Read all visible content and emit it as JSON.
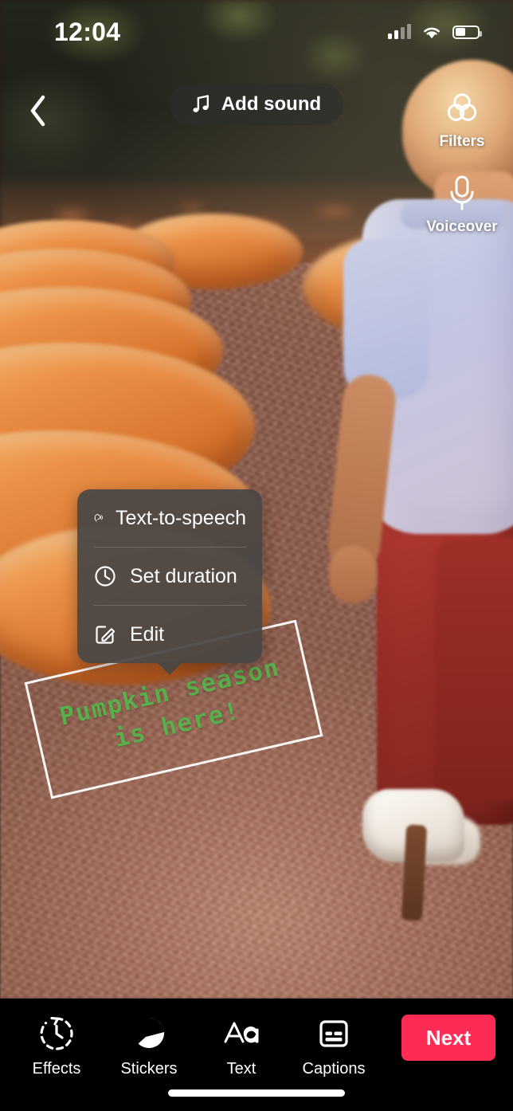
{
  "status_bar": {
    "time": "12:04",
    "signal_icon": "cellular-signal-icon",
    "wifi_icon": "wifi-icon",
    "battery_icon": "battery-icon"
  },
  "top_bar": {
    "back_icon": "back-chevron-icon",
    "add_sound_label": "Add sound",
    "add_sound_icon": "music-note-icon"
  },
  "right_rail": {
    "items": [
      {
        "label": "Filters",
        "icon": "filters-circles-icon"
      },
      {
        "label": "Voiceover",
        "icon": "microphone-icon"
      }
    ]
  },
  "context_menu": {
    "items": [
      {
        "label": "Text-to-speech",
        "icon": "text-to-speech-icon"
      },
      {
        "label": "Set duration",
        "icon": "clock-icon"
      },
      {
        "label": "Edit",
        "icon": "edit-pencil-icon"
      }
    ]
  },
  "text_overlay": {
    "text": "Pumpkin season is here!",
    "color": "#59b04a",
    "rotation_degrees": -13,
    "selected": true
  },
  "bottom_bar": {
    "tools": [
      {
        "label": "Effects",
        "icon": "effects-clock-icon"
      },
      {
        "label": "Stickers",
        "icon": "sticker-face-icon"
      },
      {
        "label": "Text",
        "icon": "text-aa-icon"
      },
      {
        "label": "Captions",
        "icon": "captions-icon"
      }
    ],
    "next_label": "Next",
    "next_color": "#FE2C55"
  },
  "home_indicator": {
    "icon": "home-indicator-bar"
  }
}
